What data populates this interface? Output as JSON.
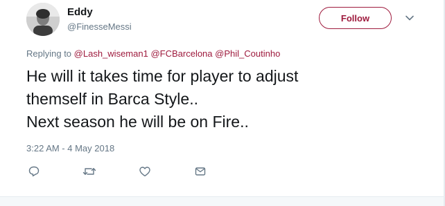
{
  "tweet": {
    "author": {
      "name": "Eddy",
      "handle": "@FinesseMessi",
      "avatar_icon": "user-avatar-photo"
    },
    "follow_label": "Follow",
    "menu_icon": "chevron-down-icon",
    "replying_to": {
      "prefix": "Replying to",
      "mentions": [
        "@Lash_wiseman1",
        "@FCBarcelona",
        "@Phil_Coutinho"
      ]
    },
    "text_lines": [
      "He will it takes time for player to adjust",
      "themself in Barca Style..",
      "Next season he will be on Fire.."
    ],
    "timestamp": "3:22 AM - 4 May 2018",
    "actions": [
      {
        "name": "reply-icon"
      },
      {
        "name": "retweet-icon"
      },
      {
        "name": "like-icon"
      },
      {
        "name": "direct-message-icon"
      }
    ],
    "colors": {
      "accent": "#9e1a3d",
      "secondary_text": "#657786",
      "primary_text": "#14171a",
      "icon": "#657786"
    }
  }
}
